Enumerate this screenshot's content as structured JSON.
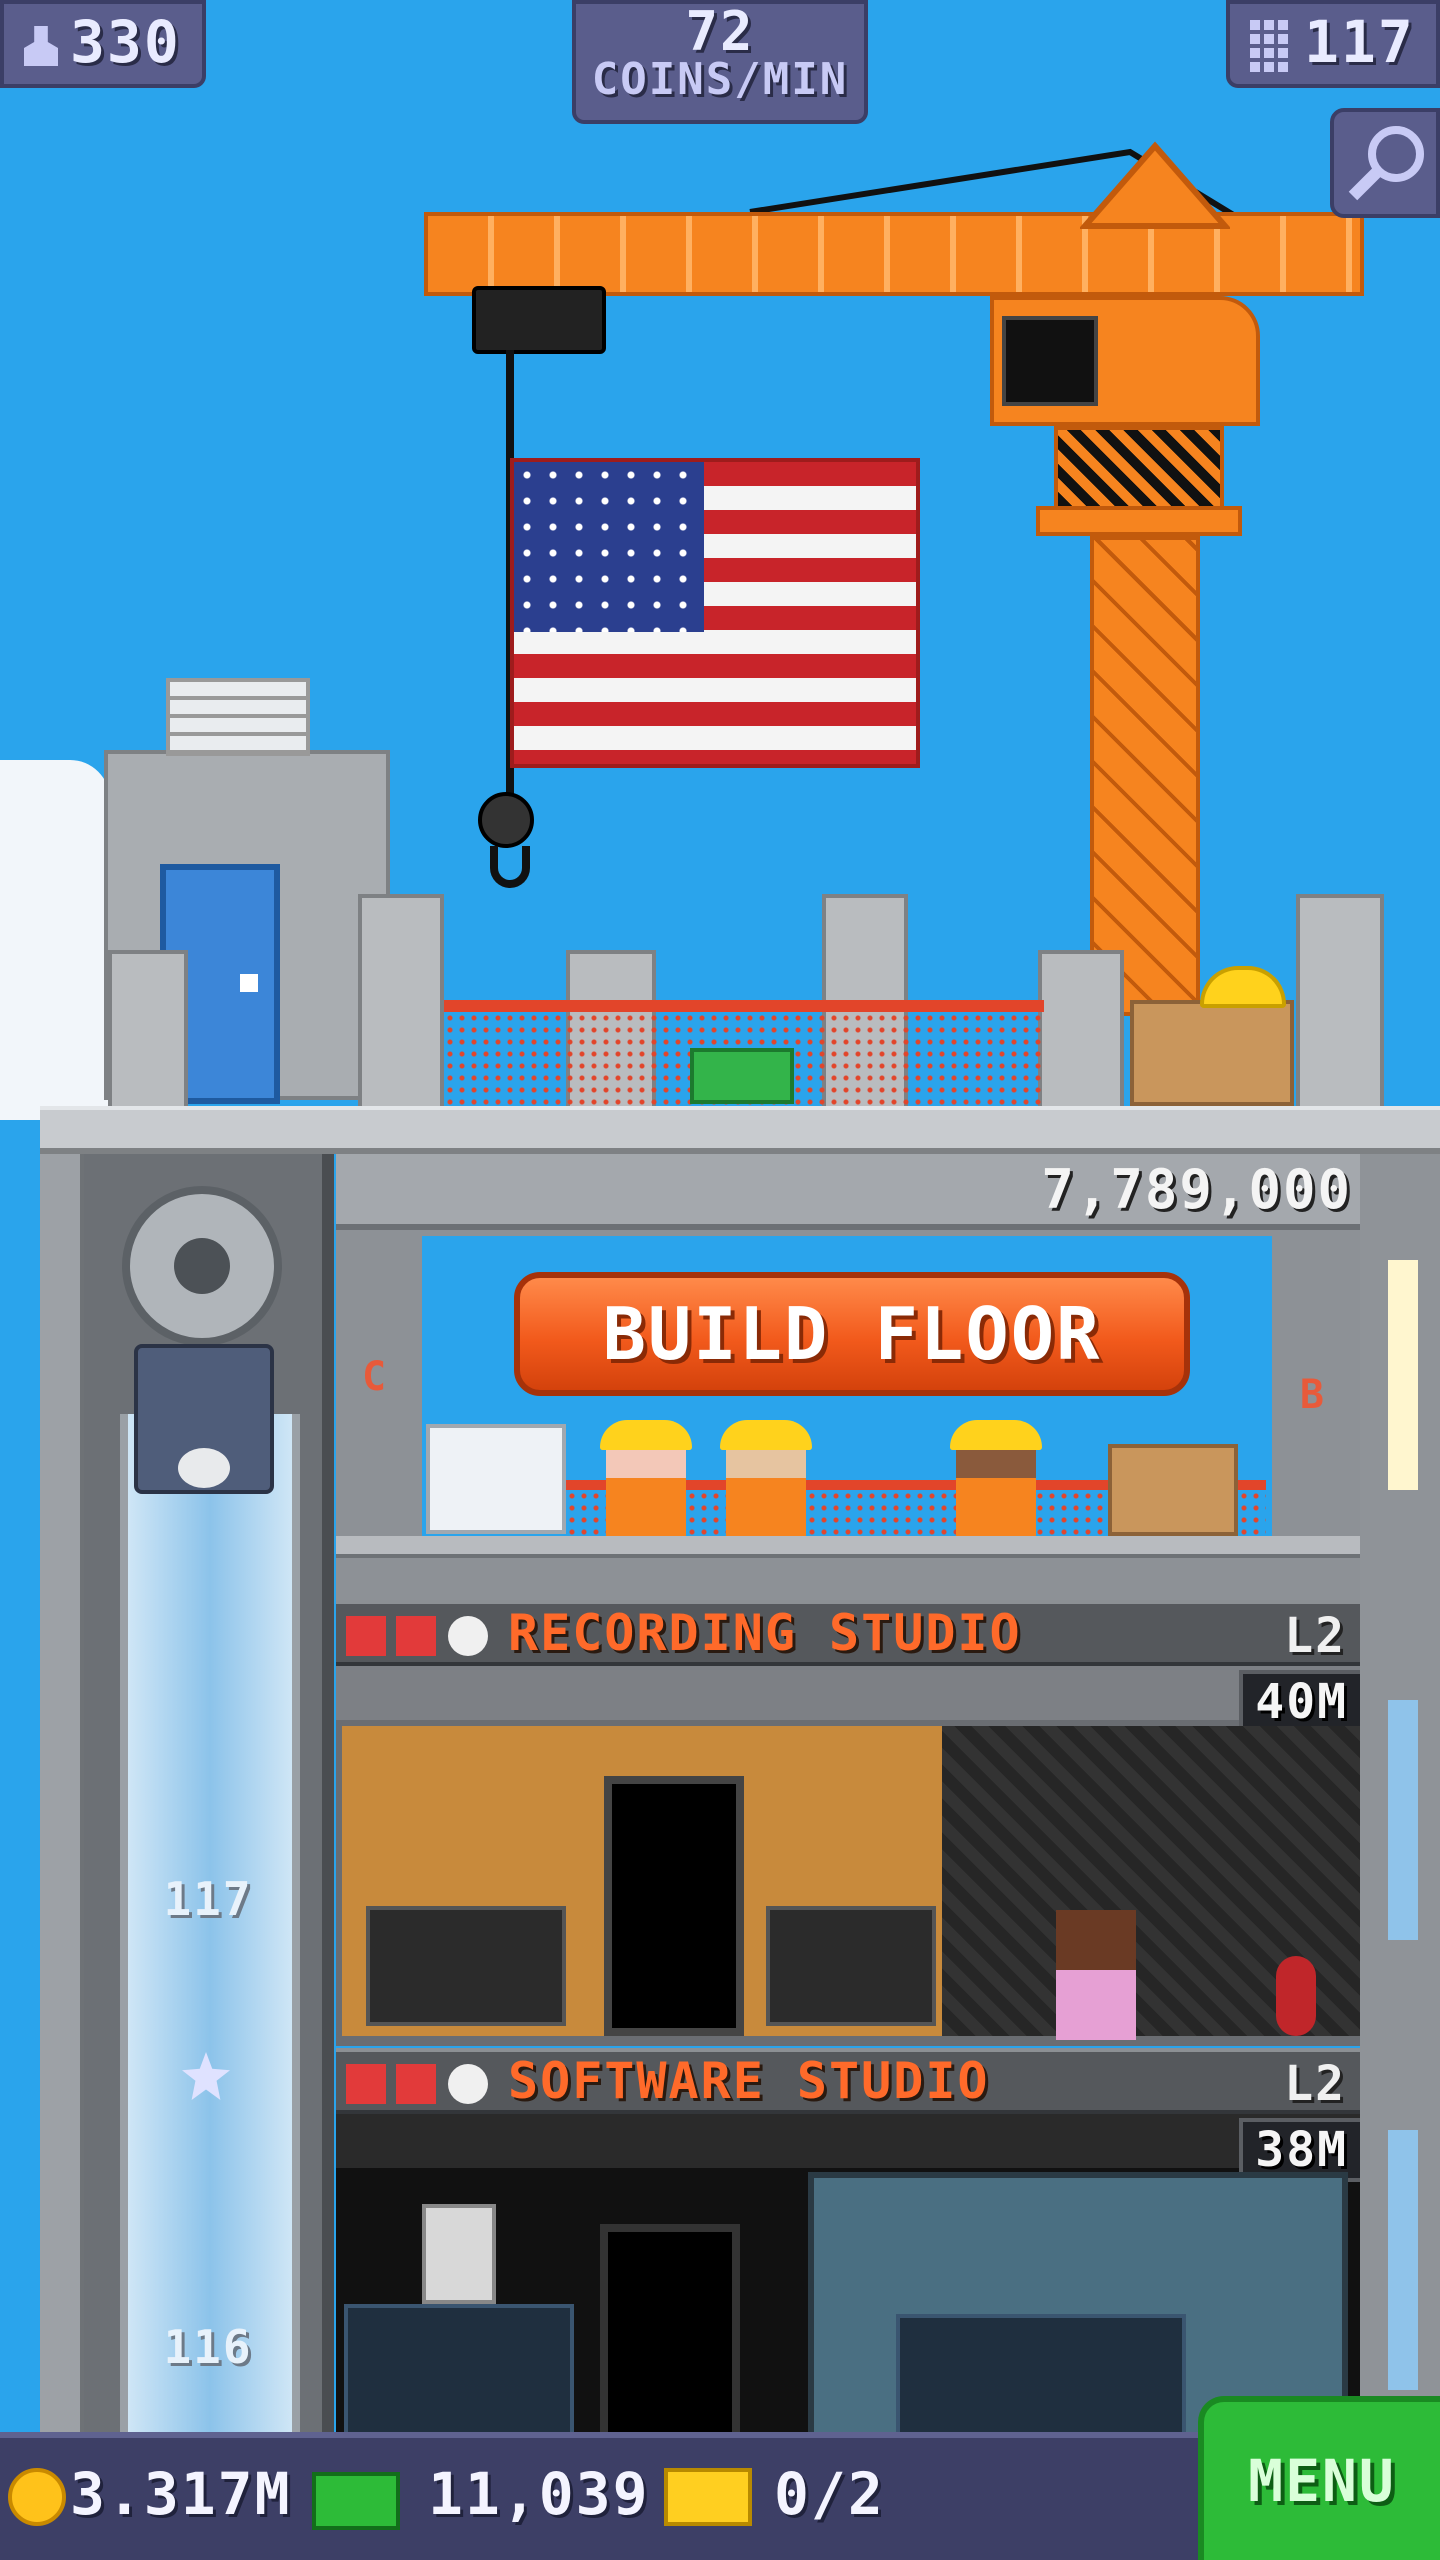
{
  "hud": {
    "population": "330",
    "coins_per_min_value": "72",
    "coins_per_min_label": "COINS/MIN",
    "floor_count": "117",
    "icons": {
      "population": "person-icon",
      "floors": "building-icon",
      "zoom": "magnifier-icon"
    }
  },
  "construction": {
    "cost": "7,789,000",
    "build_label": "BUILD FLOOR",
    "left_marker": "C",
    "right_marker": "B"
  },
  "floors": [
    {
      "name": "RECORDING STUDIO",
      "level": "L2",
      "cost": "40M"
    },
    {
      "name": "SOFTWARE STUDIO",
      "level": "L2",
      "cost": "38M"
    }
  ],
  "elevator": {
    "floor_labels": [
      "117",
      "116"
    ]
  },
  "bottom_bar": {
    "coins": "3.317M",
    "bux": "11,039",
    "tickets": "0/2",
    "menu_label": "MENU"
  },
  "colors": {
    "sky": "#2aa4ec",
    "crane": "#f6841f",
    "build_button": "#f25a1c",
    "menu": "#2dbb38",
    "hud": "#5a5d8c",
    "floor_title": "#ff6a2a"
  }
}
